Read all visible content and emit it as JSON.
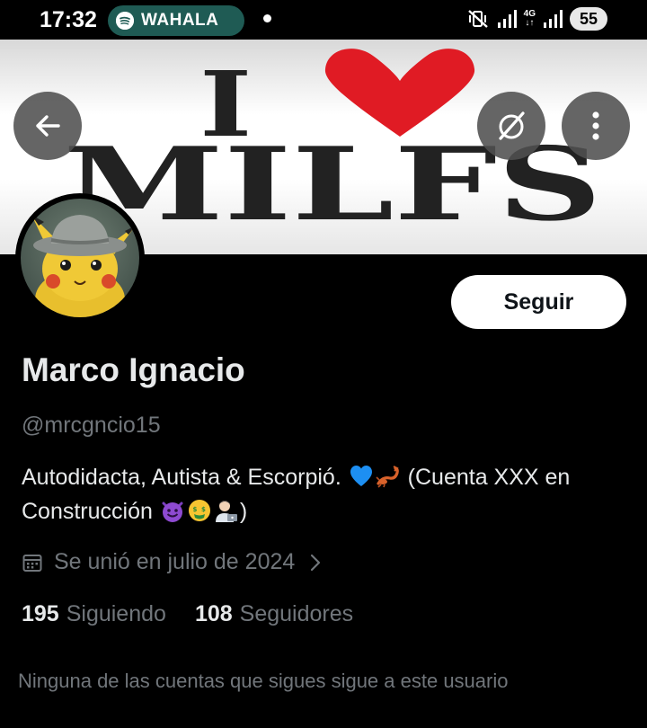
{
  "status_bar": {
    "time": "17:32",
    "notification_label": "WAHALA",
    "network_label": "4G",
    "battery": "55"
  },
  "banner": {
    "text_line1_letter": "I",
    "text_line2": "MILFS"
  },
  "icons": {
    "back": "arrow-left-icon",
    "grok": "grok-icon",
    "more": "more-vertical-icon"
  },
  "profile": {
    "follow_label": "Seguir",
    "name": "Marco Ignacio",
    "handle": "@mrcgncio15",
    "bio_part1": "Autodidacta, Autista & Escorpió. ",
    "bio_part2": " (Cuenta XXX en Construcción ",
    "bio_part3": ")",
    "joined": "Se unió en julio de 2024",
    "following_count": "195",
    "following_label": "Siguiendo",
    "followers_count": "108",
    "followers_label": "Seguidores",
    "mutual_note": "Ninguna de las cuentas que sigues sigue a este usuario"
  },
  "colors": {
    "background": "#000000",
    "text_primary": "#e7e9ea",
    "text_secondary": "#71767b",
    "heart": "#e01b24"
  }
}
